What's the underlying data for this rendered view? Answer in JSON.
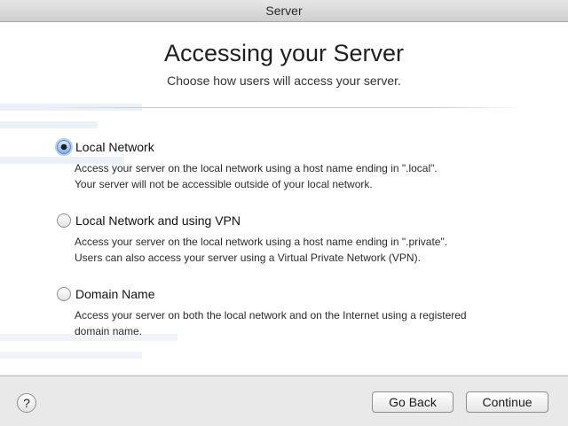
{
  "window": {
    "title": "Server"
  },
  "header": {
    "title": "Accessing your Server",
    "subtitle": "Choose how users will access your server."
  },
  "options": [
    {
      "label": "Local Network",
      "selected": true,
      "description_lines": [
        "Access your server on the local network using a host name ending in \".local\".",
        "Your server will not be accessible outside of your local network."
      ]
    },
    {
      "label": "Local Network and using VPN",
      "selected": false,
      "description_lines": [
        "Access your server on the local network using a host name ending in \".private\".",
        "Users can also access your server using a Virtual Private Network (VPN)."
      ]
    },
    {
      "label": "Domain Name",
      "selected": false,
      "description_lines": [
        "Access your server on both the local network and on the Internet using a registered",
        "domain name."
      ]
    }
  ],
  "footer": {
    "help_label": "?",
    "back_label": "Go Back",
    "continue_label": "Continue"
  },
  "colors": {
    "selection_accent": "#5a86c4",
    "window_bg": "#ececec",
    "content_bg": "#ffffff"
  }
}
